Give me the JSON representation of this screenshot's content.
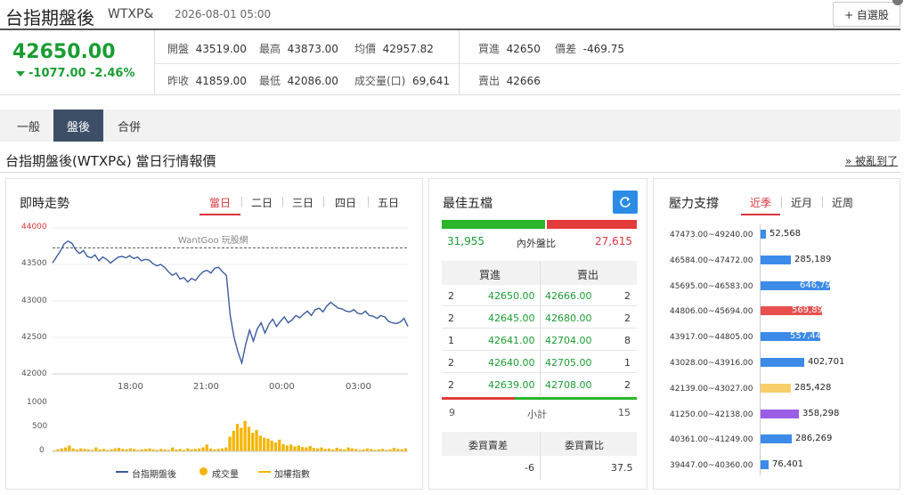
{
  "header": {
    "title": "台指期盤後",
    "code": "WTXP&",
    "datetime": "2026-08-01 05:00",
    "watchlist_button": "+ 自選股"
  },
  "quote": {
    "price": "42650.00",
    "change": "-1077.00",
    "change_pct": "-2.46%",
    "open_label": "開盤",
    "open": "43519.00",
    "high_label": "最高",
    "high": "43873.00",
    "avg_label": "均價",
    "avg": "42957.82",
    "prev_label": "昨收",
    "prev": "41859.00",
    "low_label": "最低",
    "low": "42086.00",
    "vol_label": "成交量(口)",
    "vol": "69,641",
    "bid_label": "買進",
    "bid": "42650",
    "spread_label": "價差",
    "spread": "-469.75",
    "ask_label": "賣出",
    "ask": "42666"
  },
  "tabs": [
    "一般",
    "盤後",
    "合併"
  ],
  "section": {
    "title": "台指期盤後(WTXP&) 當日行情報價",
    "more": "» 被亂到了"
  },
  "chart": {
    "title": "即時走勢",
    "range_tabs": [
      "當日",
      "二日",
      "三日",
      "四日",
      "五日"
    ],
    "watermark": "WantGoo 玩股網",
    "y_ticks": [
      "44000",
      "43500",
      "43000",
      "42500",
      "42000"
    ],
    "x_ticks": [
      "18:00",
      "21:00",
      "00:00",
      "03:00"
    ],
    "vol_ticks": [
      "1000",
      "500",
      "0"
    ],
    "legend": [
      "台指期盤後",
      "成交量",
      "加權指數"
    ],
    "colors": {
      "line": "#3a5ba0",
      "volume": "#f5b400",
      "prev_close_line": "#555555"
    }
  },
  "chart_data": {
    "type": "line",
    "ylim": [
      42000,
      44000
    ],
    "prev_close_ref": 43727,
    "x_labels": [
      "18:00",
      "21:00",
      "00:00",
      "03:00"
    ],
    "price": [
      43520,
      43600,
      43680,
      43780,
      43820,
      43790,
      43700,
      43650,
      43690,
      43610,
      43590,
      43630,
      43550,
      43600,
      43570,
      43520,
      43560,
      43600,
      43610,
      43590,
      43620,
      43580,
      43600,
      43550,
      43570,
      43560,
      43510,
      43480,
      43500,
      43460,
      43400,
      43350,
      43380,
      43300,
      43320,
      43260,
      43310,
      43280,
      43350,
      43400,
      43420,
      43380,
      43450,
      43460,
      43400,
      43350,
      42800,
      42500,
      42300,
      42150,
      42400,
      42600,
      42450,
      42620,
      42700,
      42560,
      42680,
      42750,
      42650,
      42720,
      42780,
      42700,
      42740,
      42800,
      42770,
      42820,
      42860,
      42800,
      42880,
      42900,
      42850,
      42930,
      42980,
      42940,
      42900,
      42890,
      42860,
      42850,
      42880,
      42830,
      42820,
      42860,
      42800,
      42790,
      42760,
      42800,
      42780,
      42720,
      42700,
      42690,
      42710,
      42760,
      42650
    ],
    "volume": [
      20,
      40,
      60,
      80,
      120,
      60,
      40,
      60,
      50,
      40,
      30,
      80,
      40,
      50,
      30,
      40,
      60,
      70,
      50,
      40,
      60,
      50,
      30,
      40,
      50,
      60,
      40,
      30,
      50,
      40,
      30,
      80,
      40,
      50,
      30,
      60,
      40,
      50,
      60,
      80,
      140,
      60,
      40,
      50,
      60,
      80,
      300,
      420,
      560,
      480,
      620,
      500,
      380,
      440,
      320,
      280,
      260,
      220,
      180,
      240,
      150,
      120,
      140,
      100,
      120,
      90,
      80,
      110,
      70,
      60,
      80,
      50,
      60,
      40,
      70,
      50,
      40,
      80,
      60,
      50,
      30,
      40,
      60,
      50,
      30,
      40,
      50,
      30,
      40,
      70,
      50,
      40,
      60
    ],
    "volume_ylim": [
      0,
      1000
    ]
  },
  "order_book": {
    "title": "最佳五檔",
    "bid_total": "31,955",
    "ratio_label": "內外盤比",
    "ask_total": "27,615",
    "bid_header": "買進",
    "ask_header": "賣出",
    "rows": [
      {
        "bid_qty": "2",
        "bid": "42650.00",
        "ask": "42666.00",
        "ask_qty": "2"
      },
      {
        "bid_qty": "2",
        "bid": "42645.00",
        "ask": "42680.00",
        "ask_qty": "2"
      },
      {
        "bid_qty": "1",
        "bid": "42641.00",
        "ask": "42704.00",
        "ask_qty": "8"
      },
      {
        "bid_qty": "2",
        "bid": "42640.00",
        "ask": "42705.00",
        "ask_qty": "1"
      },
      {
        "bid_qty": "2",
        "bid": "42639.00",
        "ask": "42708.00",
        "ask_qty": "2"
      }
    ],
    "sum_bid": "9",
    "sum_label": "小計",
    "sum_ask": "15",
    "diff_label": "委買賣差",
    "ratio2_label": "委買賣比",
    "diff": "-6",
    "ratio2": "37.5",
    "bar_colors": {
      "bid": "#2ab52a",
      "ask": "#e23b3b"
    }
  },
  "pressure": {
    "title": "壓力支撐",
    "tabs": [
      "近季",
      "近月",
      "近周"
    ],
    "rows": [
      {
        "range": "47473.00~49240.00",
        "value": "52,568",
        "num": 52568,
        "color": "#3d8be8"
      },
      {
        "range": "46584.00~47472.00",
        "value": "285,189",
        "num": 285189,
        "color": "#3d8be8"
      },
      {
        "range": "45695.00~46583.00",
        "value": "646,791",
        "num": 646791,
        "color": "#3d8be8"
      },
      {
        "range": "44806.00~45694.00",
        "value": "569,899",
        "num": 569899,
        "color": "#e85050"
      },
      {
        "range": "43917.00~44805.00",
        "value": "557,445",
        "num": 557445,
        "color": "#3d8be8"
      },
      {
        "range": "43028.00~43916.00",
        "value": "402,701",
        "num": 402701,
        "color": "#3d8be8"
      },
      {
        "range": "42139.00~43027.00",
        "value": "285,428",
        "num": 285428,
        "color": "#f7cf6a"
      },
      {
        "range": "41250.00~42138.00",
        "value": "358,298",
        "num": 358298,
        "color": "#9b5de5"
      },
      {
        "range": "40361.00~41249.00",
        "value": "286,269",
        "num": 286269,
        "color": "#3d8be8"
      },
      {
        "range": "39447.00~40360.00",
        "value": "76,401",
        "num": 76401,
        "color": "#3d8be8"
      }
    ]
  }
}
